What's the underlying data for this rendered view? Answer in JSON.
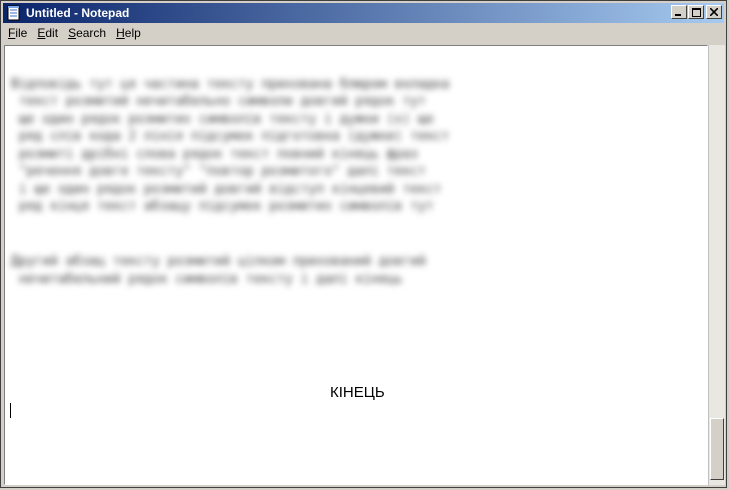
{
  "window": {
    "title": "Untitled - Notepad",
    "icon": "notepad-icon",
    "controls": {
      "minimize": "_",
      "maximize": "□",
      "close": "×"
    }
  },
  "menu": [
    {
      "id": "file",
      "access": "F",
      "rest": "ile"
    },
    {
      "id": "edit",
      "access": "E",
      "rest": "dit"
    },
    {
      "id": "search",
      "access": "S",
      "rest": "earch"
    },
    {
      "id": "help",
      "access": "H",
      "rest": "elp"
    }
  ],
  "editor": {
    "end_word": "КІНЕЦЬ"
  },
  "colors": {
    "titlebar_start": "#0a246a",
    "titlebar_end": "#a6caf0",
    "chrome": "#d4d0c8"
  }
}
